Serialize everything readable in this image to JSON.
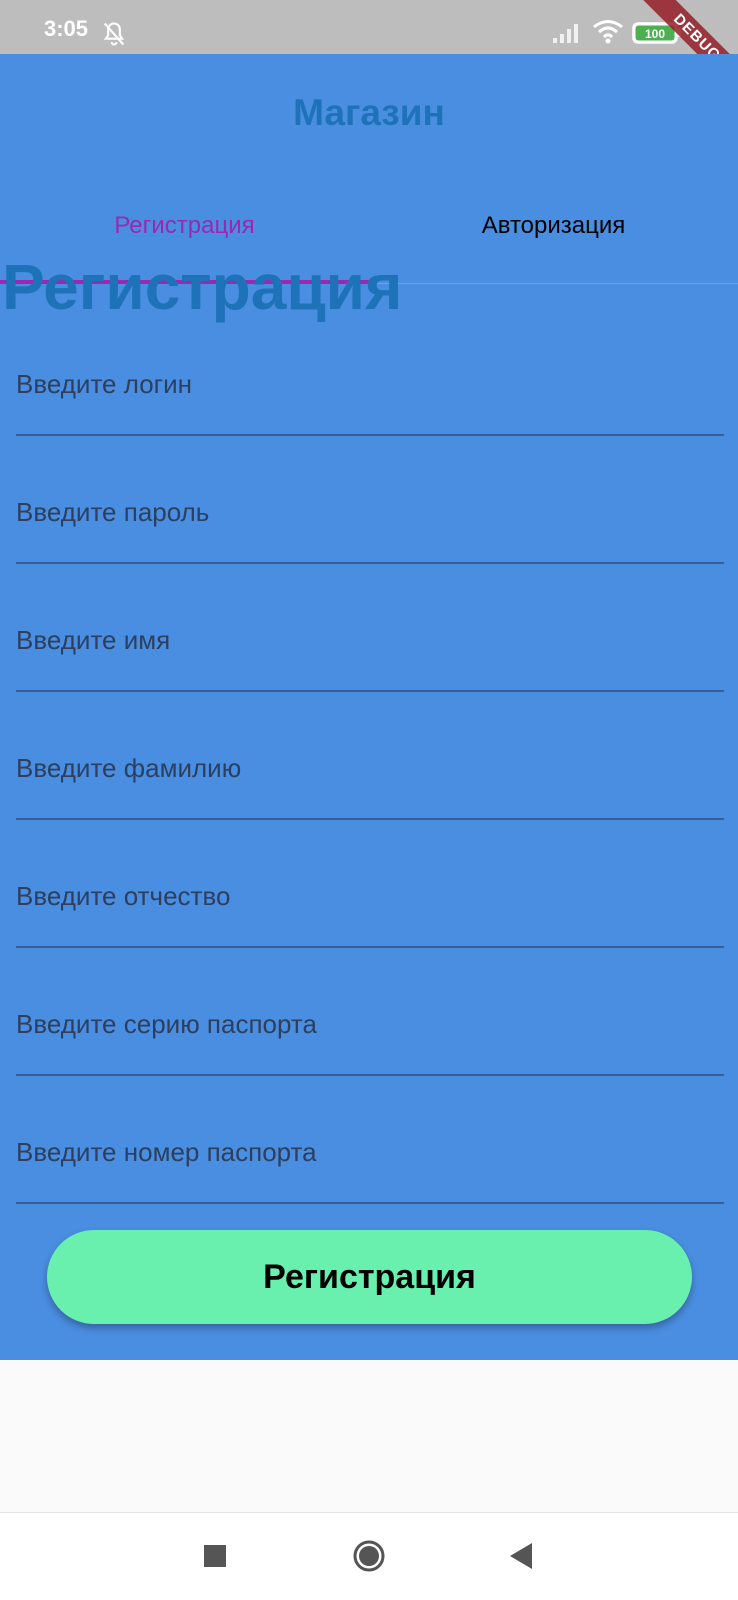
{
  "status": {
    "time": "3:05",
    "battery": "100"
  },
  "debug": "DEBUG",
  "app": {
    "title": "Магазин"
  },
  "tabs": [
    {
      "label": "Регистрация",
      "active": true
    },
    {
      "label": "Авторизация",
      "active": false
    }
  ],
  "form": {
    "title": "Регистрация",
    "fields": [
      {
        "placeholder": "Введите логин"
      },
      {
        "placeholder": "Введите пароль"
      },
      {
        "placeholder": "Введите имя"
      },
      {
        "placeholder": "Введите фамилию"
      },
      {
        "placeholder": "Введите отчество"
      },
      {
        "placeholder": "Введите серию паспорта"
      },
      {
        "placeholder": "Введите номер паспорта"
      }
    ],
    "submit_label": "Регистрация"
  },
  "colors": {
    "background": "#4a8ee2",
    "accent": "#9c27b0",
    "title": "#1e72b8",
    "button": "#69f0ae"
  },
  "icons": [
    "bell-off-icon",
    "signal-icon",
    "wifi-icon",
    "battery-icon",
    "square-icon",
    "circle-icon",
    "triangle-icon"
  ]
}
